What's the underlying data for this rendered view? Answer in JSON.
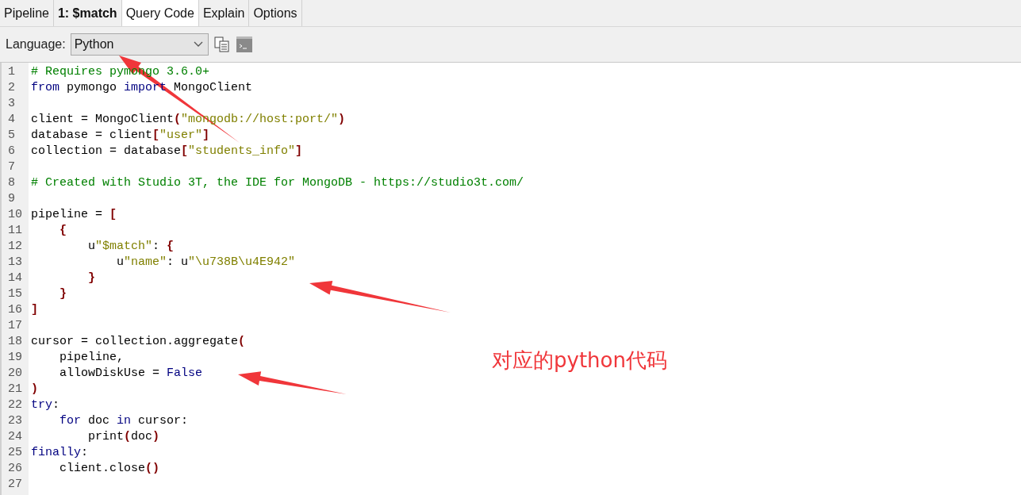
{
  "tabs": [
    {
      "label": "Pipeline",
      "kind": "plain",
      "selected": false
    },
    {
      "label": "1: $match",
      "kind": "stage",
      "selected": false
    },
    {
      "label": "Query Code",
      "kind": "plain",
      "selected": true
    },
    {
      "label": "Explain",
      "kind": "plain",
      "selected": false
    },
    {
      "label": "Options",
      "kind": "plain",
      "selected": false
    }
  ],
  "toolbar": {
    "label": "Language:",
    "language": "Python"
  },
  "code": [
    {
      "number": "1",
      "tokens": [
        {
          "kind": "comment",
          "text": "# Requires pymongo 3.6.0+"
        }
      ]
    },
    {
      "number": "2",
      "tokens": [
        {
          "kind": "keyword",
          "text": "from"
        },
        {
          "kind": "plain",
          "text": " pymongo "
        },
        {
          "kind": "keyword",
          "text": "import"
        },
        {
          "kind": "plain",
          "text": " MongoClient"
        }
      ]
    },
    {
      "number": "3"
    },
    {
      "number": "4",
      "tokens": [
        {
          "kind": "plain",
          "text": "client = MongoClient"
        },
        {
          "kind": "punct",
          "text": "("
        },
        {
          "kind": "string",
          "text": "\"mongodb://host:port/\""
        },
        {
          "kind": "punct",
          "text": ")"
        }
      ]
    },
    {
      "number": "5",
      "tokens": [
        {
          "kind": "plain",
          "text": "database = client"
        },
        {
          "kind": "punct",
          "text": "["
        },
        {
          "kind": "string",
          "text": "\"user\""
        },
        {
          "kind": "punct",
          "text": "]"
        }
      ]
    },
    {
      "number": "6",
      "tokens": [
        {
          "kind": "plain",
          "text": "collection = database"
        },
        {
          "kind": "punct",
          "text": "["
        },
        {
          "kind": "string",
          "text": "\"students_info\""
        },
        {
          "kind": "punct",
          "text": "]"
        }
      ]
    },
    {
      "number": "7"
    },
    {
      "number": "8",
      "tokens": [
        {
          "kind": "comment",
          "text": "# Created with Studio 3T, the IDE for MongoDB - https://studio3t.com/"
        }
      ]
    },
    {
      "number": "9"
    },
    {
      "number": "10",
      "tokens": [
        {
          "kind": "plain",
          "text": "pipeline = "
        },
        {
          "kind": "punct",
          "text": "["
        }
      ]
    },
    {
      "number": "11",
      "tokens": [
        {
          "kind": "punct",
          "text": "    {"
        }
      ]
    },
    {
      "number": "12",
      "tokens": [
        {
          "kind": "plain",
          "text": "        u"
        },
        {
          "kind": "string",
          "text": "\"$match\""
        },
        {
          "kind": "plain",
          "text": ": "
        },
        {
          "kind": "punct",
          "text": "{"
        }
      ]
    },
    {
      "number": "13",
      "tokens": [
        {
          "kind": "plain",
          "text": "            u"
        },
        {
          "kind": "string",
          "text": "\"name\""
        },
        {
          "kind": "plain",
          "text": ": u"
        },
        {
          "kind": "string",
          "text": "\"\\u738B\\u4E942\""
        }
      ]
    },
    {
      "number": "14",
      "tokens": [
        {
          "kind": "punct",
          "text": "        }"
        }
      ]
    },
    {
      "number": "15",
      "tokens": [
        {
          "kind": "punct",
          "text": "    }"
        }
      ]
    },
    {
      "number": "16",
      "tokens": [
        {
          "kind": "punct",
          "text": "]"
        }
      ]
    },
    {
      "number": "17"
    },
    {
      "number": "18",
      "tokens": [
        {
          "kind": "plain",
          "text": "cursor = collection.aggregate"
        },
        {
          "kind": "punct",
          "text": "("
        }
      ]
    },
    {
      "number": "19",
      "tokens": [
        {
          "kind": "plain",
          "text": "    pipeline,"
        }
      ]
    },
    {
      "number": "20",
      "tokens": [
        {
          "kind": "plain",
          "text": "    allowDiskUse = "
        },
        {
          "kind": "keyword",
          "text": "False"
        }
      ]
    },
    {
      "number": "21",
      "tokens": [
        {
          "kind": "punct",
          "text": ")"
        }
      ]
    },
    {
      "number": "22",
      "tokens": [
        {
          "kind": "keyword",
          "text": "try"
        },
        {
          "kind": "plain",
          "text": ":"
        }
      ]
    },
    {
      "number": "23",
      "tokens": [
        {
          "kind": "keyword",
          "text": "    for"
        },
        {
          "kind": "plain",
          "text": " doc "
        },
        {
          "kind": "keyword",
          "text": "in"
        },
        {
          "kind": "plain",
          "text": " cursor:"
        }
      ]
    },
    {
      "number": "24",
      "tokens": [
        {
          "kind": "plain",
          "text": "        print"
        },
        {
          "kind": "punct",
          "text": "("
        },
        {
          "kind": "plain",
          "text": "doc"
        },
        {
          "kind": "punct",
          "text": ")"
        }
      ]
    },
    {
      "number": "25",
      "tokens": [
        {
          "kind": "keyword",
          "text": "finally"
        },
        {
          "kind": "plain",
          "text": ":"
        }
      ]
    },
    {
      "number": "26",
      "tokens": [
        {
          "kind": "plain",
          "text": "    client.close"
        },
        {
          "kind": "punct",
          "text": "()"
        }
      ]
    },
    {
      "number": "27"
    }
  ],
  "annotation": {
    "text": "对应的python代码"
  }
}
